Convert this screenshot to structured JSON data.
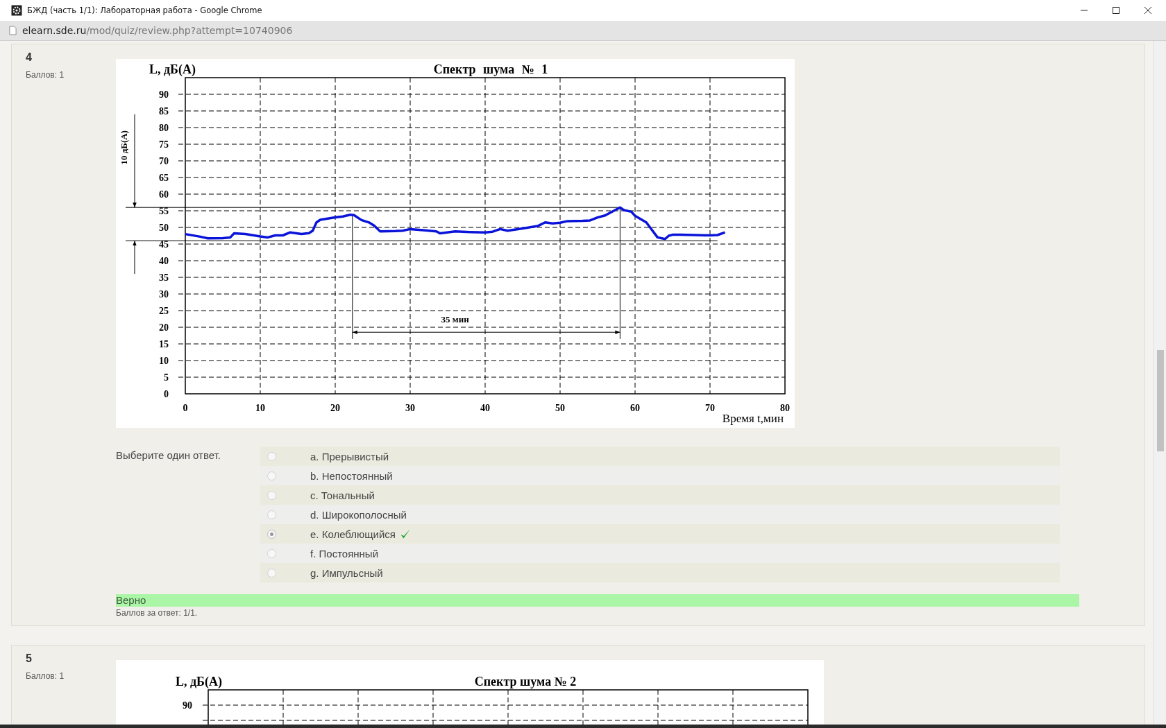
{
  "window": {
    "title": "БЖД (часть 1/1): Лабораторная работа - Google Chrome"
  },
  "address_bar": {
    "host": "elearn.sde.ru",
    "path": "/mod/quiz/review.php?attempt=10740906"
  },
  "questions": [
    {
      "number": "4",
      "points": "Баллов: 1",
      "chart_data": {
        "type": "line",
        "title": "Спектр шума № 1",
        "xlabel": "Время t,мин",
        "ylabel": "L, дБ(А)",
        "xlim": [
          0,
          80
        ],
        "ylim": [
          0,
          95
        ],
        "xticks": [
          0,
          10,
          20,
          30,
          40,
          50,
          60,
          70,
          80
        ],
        "yticks": [
          0,
          5,
          10,
          15,
          20,
          25,
          30,
          35,
          40,
          45,
          50,
          55,
          60,
          65,
          70,
          75,
          80,
          85,
          90
        ],
        "x": [
          0,
          2,
          3,
          5,
          6,
          6.5,
          8,
          10,
          11,
          12,
          13,
          14,
          15.5,
          16.5,
          17,
          17.5,
          18,
          20,
          21,
          22,
          22.5,
          23.5,
          24.5,
          25.2,
          26,
          28,
          29,
          30,
          32,
          33.5,
          34,
          36,
          38,
          40,
          41,
          42,
          43,
          45,
          47,
          48,
          49,
          50,
          51,
          53,
          54,
          55,
          56,
          57,
          58,
          58.5,
          59.5,
          60,
          61.5,
          62,
          63,
          64,
          64.5,
          65,
          66,
          68,
          70,
          71,
          72
        ],
        "grid": true,
        "series": [
          {
            "color": "#0a14d8",
            "values": [
              48,
              47.2,
              46.7,
              46.8,
              47,
              48.2,
              48,
              47.3,
              47,
              47.6,
              47.6,
              48.5,
              48,
              48.3,
              49,
              51.5,
              52.3,
              53,
              53.3,
              53.8,
              53.7,
              52.2,
              51.5,
              50.5,
              48.8,
              48.9,
              49,
              49.5,
              49.1,
              48.8,
              48.2,
              48.8,
              48.6,
              48.5,
              48.7,
              49.5,
              49,
              49.7,
              50.4,
              51.5,
              51.2,
              51.4,
              51.9,
              52,
              52.1,
              53,
              53.6,
              54.8,
              56,
              55.2,
              54.7,
              53.5,
              51.5,
              50,
              47,
              46.5,
              47.5,
              47.8,
              47.8,
              47.7,
              47.6,
              47.7,
              48.5
            ]
          }
        ],
        "ref_lines": [
          {
            "axis": "y",
            "value": 56
          },
          {
            "axis": "y",
            "value": 46
          },
          {
            "axis": "x",
            "value": 22.3
          },
          {
            "axis": "x",
            "value": 58
          }
        ],
        "annotations": [
          "10 дБ(А)",
          "35 мин"
        ]
      },
      "prompt": "Выберите один ответ.",
      "answers": [
        {
          "label": "a. Прерывистый",
          "selected": false,
          "correct": false
        },
        {
          "label": "b. Непостоянный",
          "selected": false,
          "correct": false
        },
        {
          "label": "c. Тональный",
          "selected": false,
          "correct": false
        },
        {
          "label": "d. Широкополосный",
          "selected": false,
          "correct": false
        },
        {
          "label": "e. Колеблющийся",
          "selected": true,
          "correct": true
        },
        {
          "label": "f. Постоянный",
          "selected": false,
          "correct": false
        },
        {
          "label": "g. Импульсный",
          "selected": false,
          "correct": false
        }
      ],
      "feedback": "Верно",
      "score": "Баллов за ответ: 1/1."
    },
    {
      "number": "5",
      "points": "Баллов: 1",
      "chart_preview": {
        "title": "Спектр шума № 2",
        "ylabel": "L, дБ(А)",
        "tick": "90"
      }
    }
  ]
}
